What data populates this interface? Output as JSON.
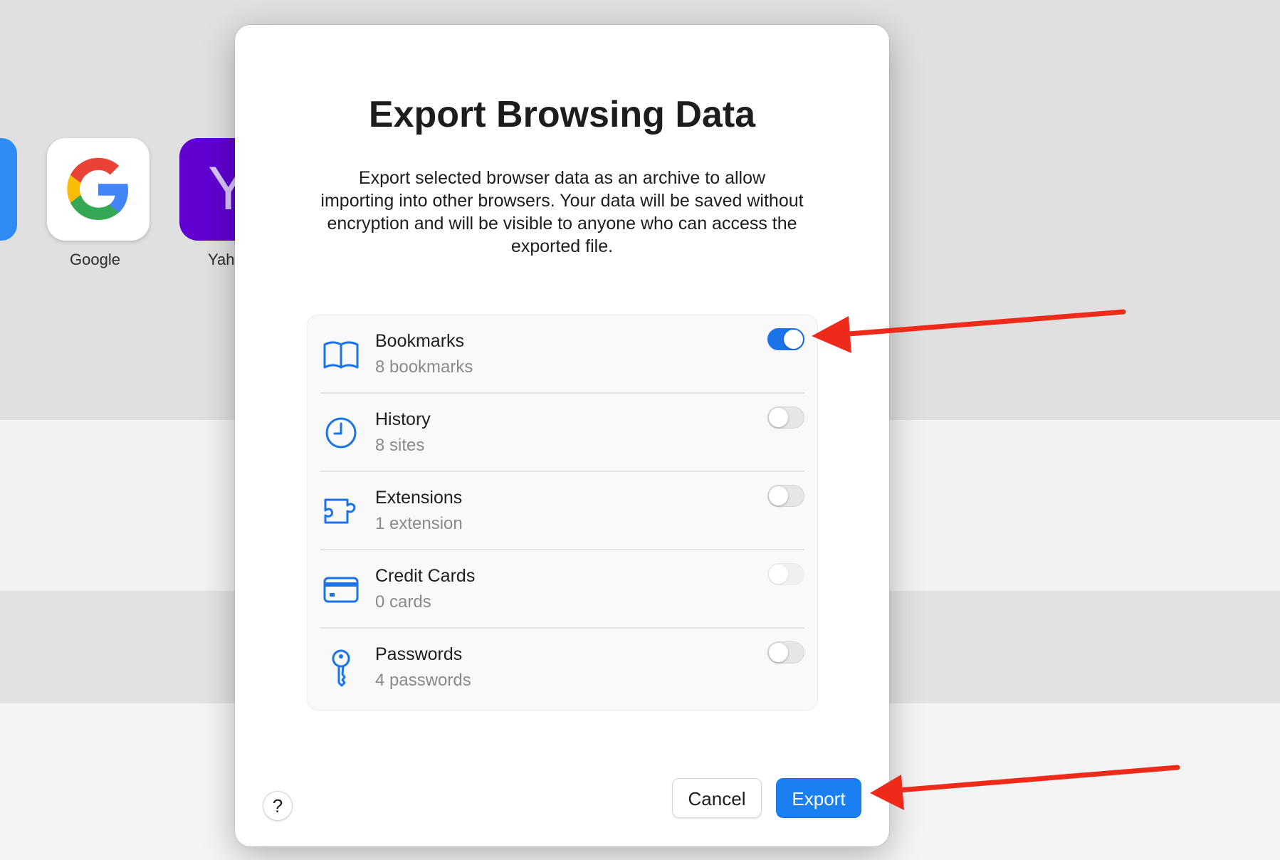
{
  "background": {
    "favorites": [
      {
        "label": "Google",
        "icon": "google-logo-icon"
      },
      {
        "label": "Yah",
        "icon": "yahoo-logo-icon",
        "glyph": "Y"
      }
    ]
  },
  "dialog": {
    "title": "Export Browsing Data",
    "description": "Export selected browser data as an archive to allow importing into other browsers. Your data will be saved without encryption and will be visible to anyone who can access the exported file.",
    "options": [
      {
        "name": "Bookmarks",
        "count": "8 bookmarks",
        "icon": "book-icon",
        "enabled": true
      },
      {
        "name": "History",
        "count": "8 sites",
        "icon": "clock-icon",
        "enabled": false
      },
      {
        "name": "Extensions",
        "count": "1 extension",
        "icon": "puzzle-piece-icon",
        "enabled": false
      },
      {
        "name": "Credit Cards",
        "count": "0 cards",
        "icon": "credit-card-icon",
        "enabled": false,
        "disabled": true
      },
      {
        "name": "Passwords",
        "count": "4 passwords",
        "icon": "key-icon",
        "enabled": false
      }
    ],
    "help_label": "?",
    "cancel_label": "Cancel",
    "export_label": "Export"
  },
  "colors": {
    "accent": "#1a7ff0",
    "annotation_arrow": "#ee2a1b",
    "icon_blue": "#1a73e8"
  }
}
